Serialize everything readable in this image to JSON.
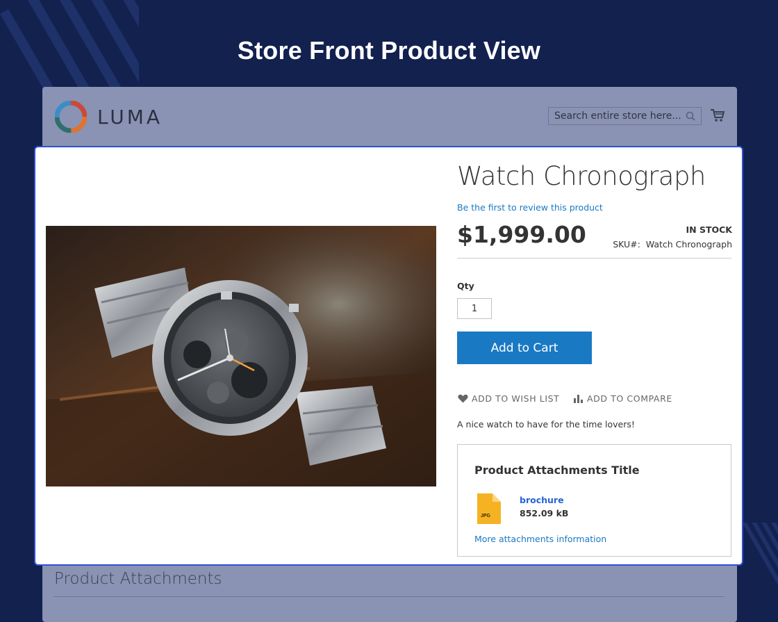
{
  "page": {
    "heading": "Store Front Product View"
  },
  "header": {
    "logo_text": "LUMA",
    "search_placeholder": "Search entire store here...",
    "cart_icon": "shopping-cart-icon",
    "search_icon": "magnifier-icon"
  },
  "product": {
    "name": "Watch Chronograph",
    "review_link": "Be the first to review this product",
    "price": "$1,999.00",
    "stock": "IN STOCK",
    "sku_label": "SKU#:",
    "sku_value": "Watch Chronograph",
    "qty_label": "Qty",
    "qty_value": "1",
    "add_to_cart": "Add to Cart",
    "wishlist": "ADD TO WISH LIST",
    "compare": "ADD TO COMPARE",
    "description": "A nice watch to have for the time lovers!"
  },
  "attachments": {
    "title": "Product Attachments Title",
    "file": {
      "name": "brochure",
      "size": "852.09 kB",
      "type": "JPG"
    },
    "more_link": "More attachments information"
  },
  "section": {
    "heading": "Product Attachments"
  },
  "colors": {
    "accent": "#1979c3",
    "highlight_border": "#2f4fd6",
    "page_bg": "#13214f",
    "file_icon": "#f5b324"
  }
}
